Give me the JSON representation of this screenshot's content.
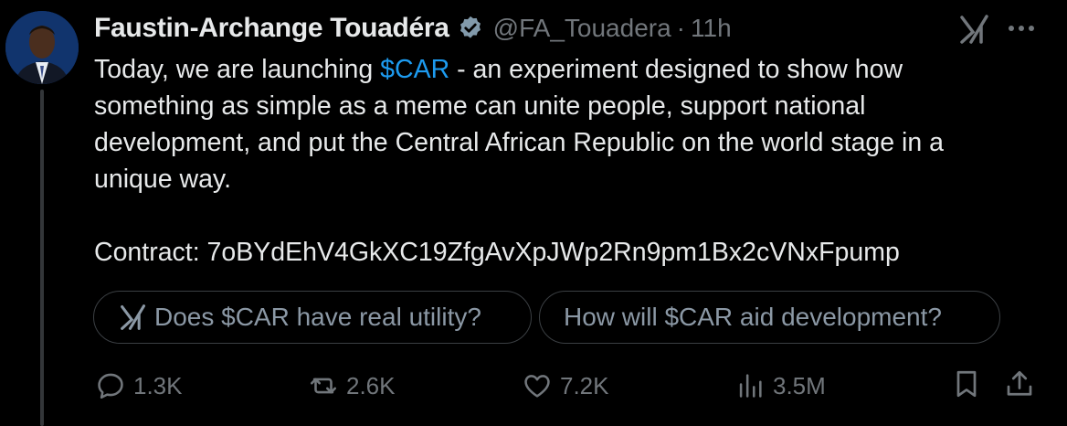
{
  "author": {
    "display_name": "Faustin-Archange Touadéra",
    "handle": "@FA_Touadera",
    "separator": "·",
    "time": "11h",
    "verified_icon": "verified-badge-icon"
  },
  "tweet": {
    "line1_pre": "Today, we are launching ",
    "cashtag": "$CAR",
    "line1_post": " - an experiment designed to show how",
    "line2": "something as simple as a meme can unite people, support national",
    "line3": "development, and put the Central African Republic on the world stage in a",
    "line4": "unique way.",
    "contract": "Contract: 7oBYdEhV4GkXC19ZfgAvXpJWp2Rn9pm1Bx2cVNxFpump"
  },
  "suggestions": [
    {
      "label": "Does $CAR have real utility?",
      "icon": "grok-icon"
    },
    {
      "label": "How will $CAR aid development?"
    }
  ],
  "actions": {
    "replies": "1.3K",
    "reposts": "2.6K",
    "likes": "7.2K",
    "views": "3.5M"
  },
  "colors": {
    "background": "#000000",
    "text": "#e7e9ea",
    "muted": "#71767b",
    "accent": "#1d9bf0"
  }
}
